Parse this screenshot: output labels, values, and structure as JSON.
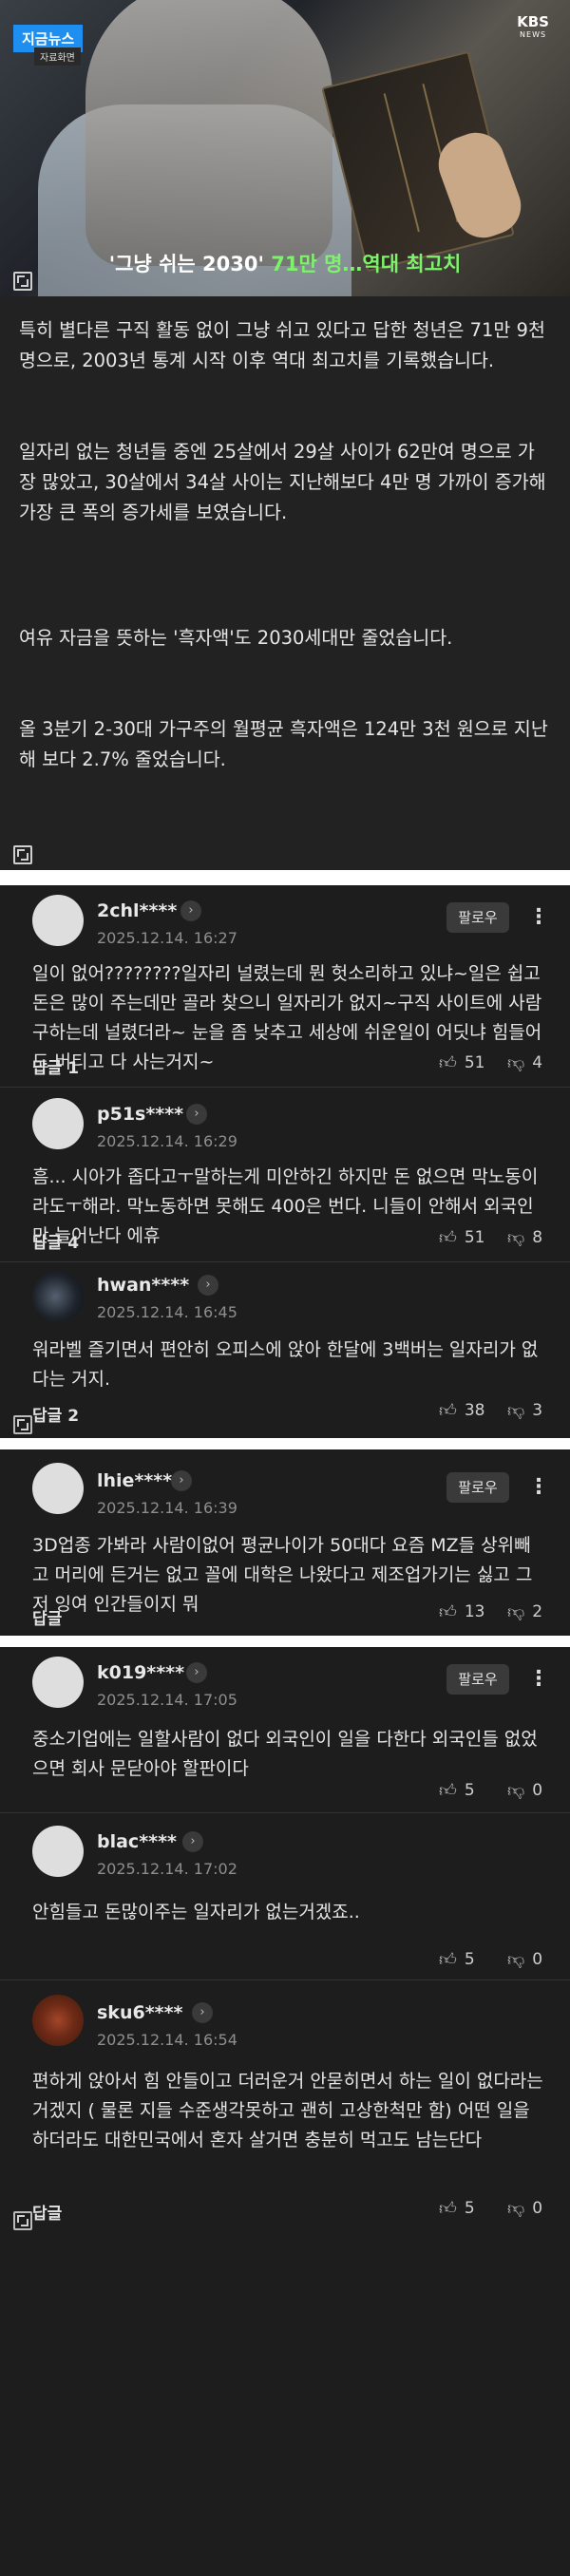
{
  "hero": {
    "badge_live": "지금뉴스",
    "badge_sub": "자료화면",
    "broadcaster": "KBS",
    "broadcaster_sub": "NEWS",
    "caption_quote": "'그냥 쉬는 2030'",
    "caption_highlight": "71만 명…역대 최고치"
  },
  "article": {
    "paragraphs": [
      "특히 별다른 구직 활동 없이 그냥 쉬고 있다고 답한 청년은 71만 9천 명으로, 2003년 통계 시작 이후 역대 최고치를 기록했습니다.",
      "일자리 없는 청년들 중엔 25살에서 29살 사이가 62만여 명으로 가장 많았고, 30살에서 34살 사이는 지난해보다 4만 명 가까이 증가해 가장 큰 폭의 증가세를 보였습니다.",
      "여유 자금을 뜻하는 '흑자액'도 2030세대만 줄었습니다.",
      "올 3분기 2-30대 가구주의 월평균 흑자액은 124만 3천 원으로 지난해 보다 2.7% 줄었습니다."
    ]
  },
  "ui": {
    "follow_label": "팔로우",
    "more_label": "⋮",
    "chevron": "›",
    "thumbs_up_icon": "thumbs-up-icon",
    "thumbs_down_icon": "thumbs-down-icon"
  },
  "comments": [
    {
      "username": "2chl****",
      "date": "2025.12.14. 16:27",
      "text": "일이 없어????????일자리 널렸는데 뭔 헛소리하고 있냐~일은 쉽고 돈은 많이 주는데만 골라 찾으니 일자리가 없지~구직 사이트에 사람 구하는데 널렸더라~ 눈을 좀 낮추고 세상에 쉬운일이 어딧냐 힘들어도 버티고 다 사는거지~",
      "reply": "답글 1",
      "likes": "51",
      "dislikes": "4"
    },
    {
      "username": "p51s****",
      "date": "2025.12.14. 16:29",
      "text": "흠... 시아가 좁다고ㅜ말하는게 미안하긴 하지만 돈 없으면 막노동이라도ㅜ해라. 막노동하면 못해도 400은 번다. 니들이 안해서 외국인만 늘어난다 에휴",
      "reply": "답글 4",
      "likes": "51",
      "dislikes": "8"
    },
    {
      "username": "hwan****",
      "date": "2025.12.14. 16:45",
      "text": "워라벨 즐기면서 편안히 오피스에 앉아 한달에 3백버는 일자리가 없다는 거지.",
      "reply": "답글 2",
      "likes": "38",
      "dislikes": "3"
    },
    {
      "username": "lhie****",
      "date": "2025.12.14. 16:39",
      "text": "3D업종 가봐라 사람이없어 평균나이가 50대다 요즘 MZ들 상위빼고 머리에 든거는 없고 꼴에 대학은 나왔다고 제조업가기는 싫고 그저 잉여 인간들이지 뭐",
      "reply": "답글",
      "likes": "13",
      "dislikes": "2"
    },
    {
      "username": "k019****",
      "date": "2025.12.14. 17:05",
      "text": "중소기업에는 일할사람이 없다 외국인이 일을 다한다 외국인들 없었으면 회사 문닫아야 할판이다",
      "reply": "",
      "likes": "5",
      "dislikes": "0"
    },
    {
      "username": "blac****",
      "date": "2025.12.14. 17:02",
      "text": "안힘들고 돈많이주는 일자리가 없는거겠죠..",
      "reply": "",
      "likes": "5",
      "dislikes": "0"
    },
    {
      "username": "sku6****",
      "date": "2025.12.14. 16:54",
      "text": "편하게 앉아서 힘 안들이고 더러운거 안묻히면서 하는 일이 없다라는 거겠지 ( 물론 지들 수준생각못하고 괜히 고상한척만 함) 어떤 일을 하더라도 대한민국에서 혼자 살거면 충분히 먹고도 남는단다",
      "reply": "답글",
      "likes": "5",
      "dislikes": "0"
    }
  ]
}
